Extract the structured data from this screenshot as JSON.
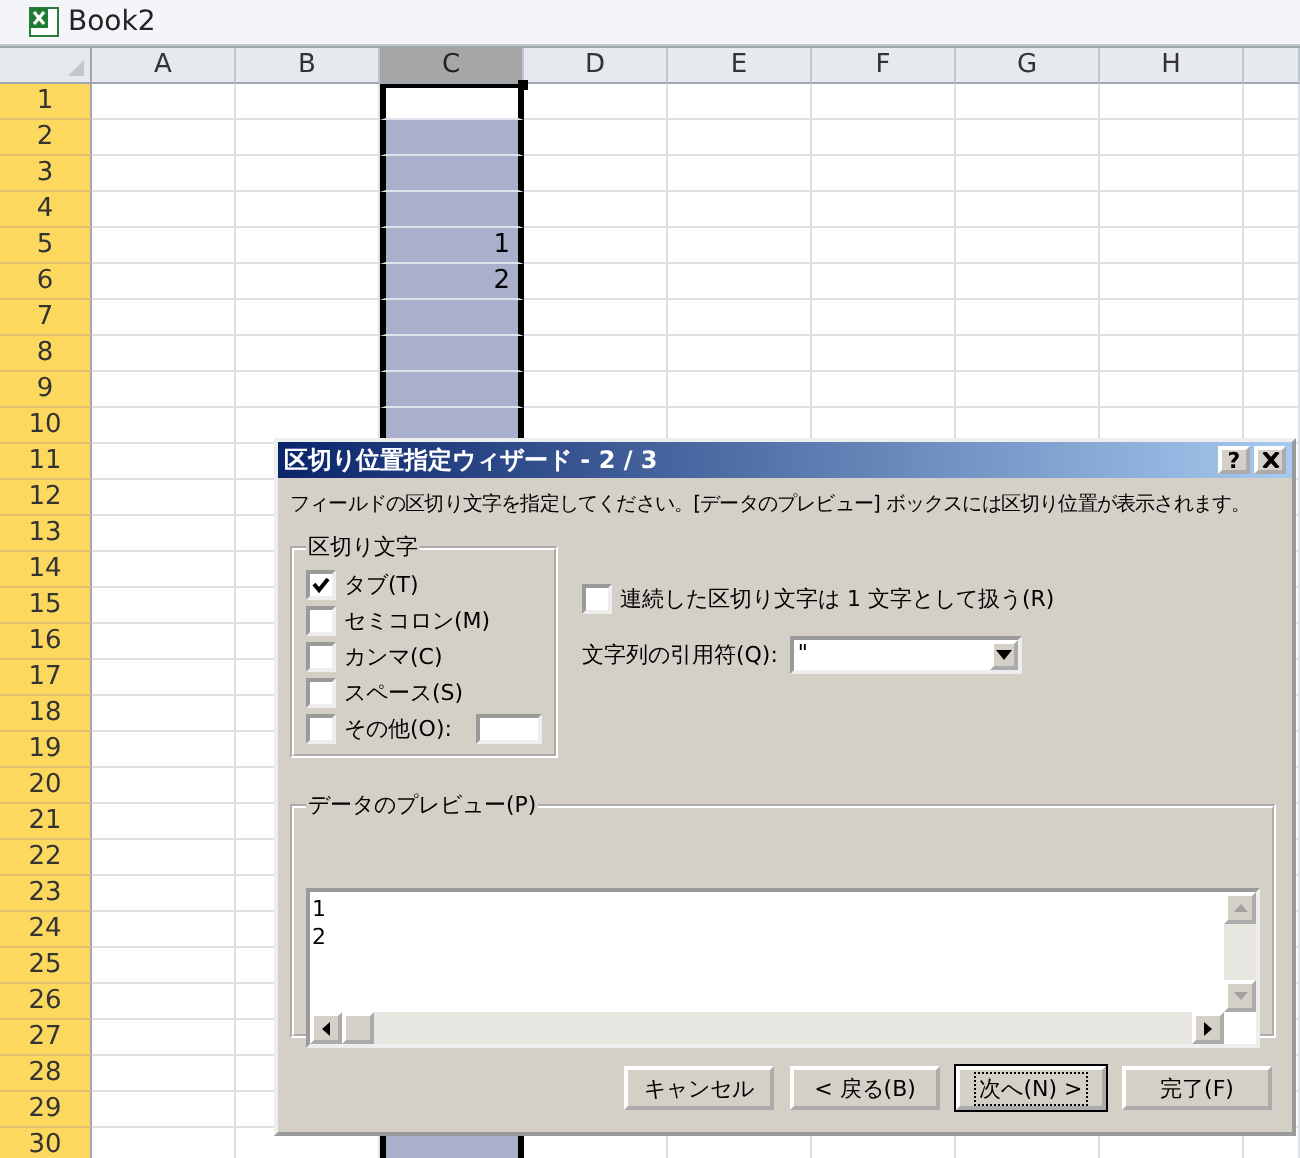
{
  "window": {
    "title": "Book2"
  },
  "sheet": {
    "columns": [
      {
        "label": "A",
        "selected": false
      },
      {
        "label": "B",
        "selected": false
      },
      {
        "label": "C",
        "selected": true
      },
      {
        "label": "D",
        "selected": false
      },
      {
        "label": "E",
        "selected": false
      },
      {
        "label": "F",
        "selected": false
      },
      {
        "label": "G",
        "selected": false
      },
      {
        "label": "H",
        "selected": false
      }
    ],
    "rows": [
      {
        "label": "1",
        "active": true
      },
      {
        "label": "2",
        "active": false
      },
      {
        "label": "3",
        "active": false
      },
      {
        "label": "4",
        "active": false
      },
      {
        "label": "5",
        "active": false,
        "c_value": "1"
      },
      {
        "label": "6",
        "active": false,
        "c_value": "2"
      },
      {
        "label": "7",
        "active": false
      },
      {
        "label": "8",
        "active": false
      },
      {
        "label": "9",
        "active": false
      },
      {
        "label": "10",
        "active": false
      },
      {
        "label": "11",
        "active": false
      },
      {
        "label": "12",
        "active": false
      },
      {
        "label": "13",
        "active": false
      },
      {
        "label": "14",
        "active": false
      },
      {
        "label": "15",
        "active": false
      },
      {
        "label": "16",
        "active": false
      },
      {
        "label": "17",
        "active": false
      },
      {
        "label": "18",
        "active": false
      },
      {
        "label": "19",
        "active": false
      },
      {
        "label": "20",
        "active": false
      },
      {
        "label": "21",
        "active": false
      },
      {
        "label": "22",
        "active": false
      },
      {
        "label": "23",
        "active": false
      },
      {
        "label": "24",
        "active": false
      },
      {
        "label": "25",
        "active": false
      },
      {
        "label": "26",
        "active": false
      },
      {
        "label": "27",
        "active": false
      },
      {
        "label": "28",
        "active": false
      },
      {
        "label": "29",
        "active": false
      },
      {
        "label": "30",
        "active": false
      }
    ]
  },
  "dialog": {
    "title": "区切り位置指定ウィザード - 2 / 3",
    "help_button": "?",
    "instruction": "フィールドの区切り文字を指定してください。[データのプレビュー] ボックスには区切り位置が表示されます。",
    "delimiters": {
      "label": "区切り文字",
      "options": [
        {
          "label": "タブ(T)",
          "checked": true
        },
        {
          "label": "セミコロン(M)",
          "checked": false
        },
        {
          "label": "カンマ(C)",
          "checked": false
        },
        {
          "label": "スペース(S)",
          "checked": false
        },
        {
          "label": "その他(O):",
          "checked": false,
          "kind": "other"
        }
      ]
    },
    "consecutive": {
      "label": "連続した区切り文字は 1 文字として扱う(R)",
      "checked": false
    },
    "text_qualifier": {
      "label": "文字列の引用符(Q):",
      "value": "\""
    },
    "preview": {
      "label": "データのプレビュー(P)",
      "lines": [
        "1",
        "2"
      ]
    },
    "buttons": [
      {
        "label": "キャンセル",
        "default": false
      },
      {
        "label": "< 戻る(B)",
        "default": false
      },
      {
        "label": "次へ(N) >",
        "default": true
      },
      {
        "label": "完了(F)",
        "default": false
      }
    ]
  }
}
